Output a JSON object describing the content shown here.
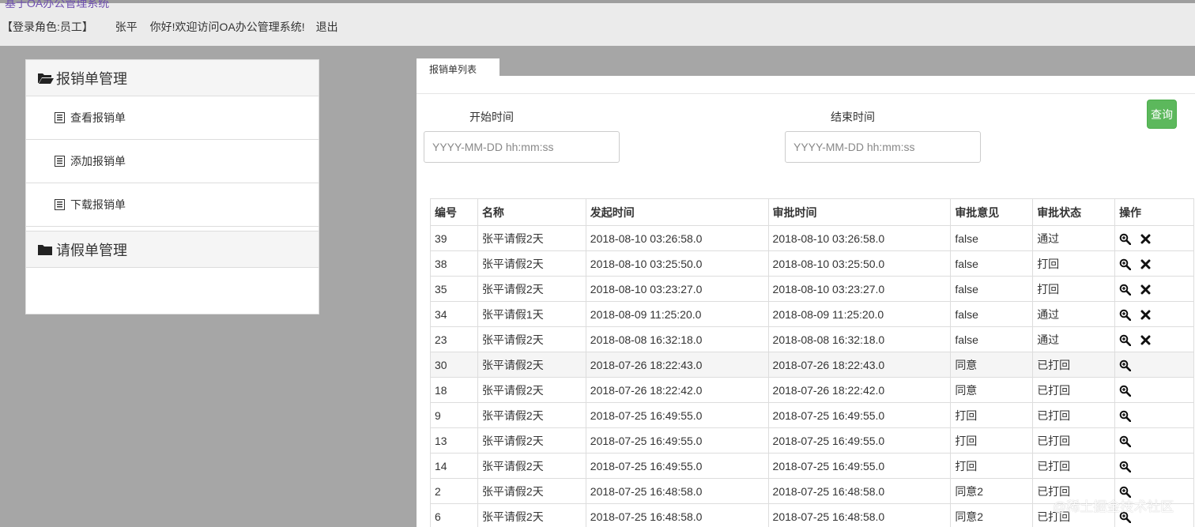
{
  "header": {
    "title_partial": "基于OA办公管理系统",
    "role": "【登录角色:员工】",
    "username": "张平",
    "greeting": "你好!欢迎访问OA办公管理系统!",
    "logout": "退出"
  },
  "sidebar": {
    "sections": [
      {
        "title": "报销单管理",
        "icon": "folder-open-icon",
        "items": [
          {
            "label": "查看报销单",
            "icon": "list-alt-icon"
          },
          {
            "label": "添加报销单",
            "icon": "list-alt-icon"
          },
          {
            "label": "下载报销单",
            "icon": "list-alt-icon"
          }
        ]
      },
      {
        "title": "请假单管理",
        "icon": "folder-closed-icon"
      }
    ]
  },
  "main": {
    "tab_label": "报销单列表",
    "filter": {
      "start_label": "开始时间",
      "end_label": "结束时间",
      "start_placeholder": "YYYY-MM-DD hh:mm:ss",
      "end_placeholder": "YYYY-MM-DD hh:mm:ss",
      "query_button": "查询"
    },
    "table": {
      "headers": [
        "编号",
        "名称",
        "发起时间",
        "审批时间",
        "审批意见",
        "审批状态",
        "操作"
      ],
      "rows": [
        {
          "id": "39",
          "name": "张平请假2天",
          "start": "2018-08-10 03:26:58.0",
          "approve": "2018-08-10 03:26:58.0",
          "opinion": "false",
          "status": "通过",
          "actions": [
            "zoom-in-icon",
            "remove-icon"
          ]
        },
        {
          "id": "38",
          "name": "张平请假2天",
          "start": "2018-08-10 03:25:50.0",
          "approve": "2018-08-10 03:25:50.0",
          "opinion": "false",
          "status": "打回",
          "actions": [
            "zoom-in-icon",
            "remove-icon"
          ]
        },
        {
          "id": "35",
          "name": "张平请假2天",
          "start": "2018-08-10 03:23:27.0",
          "approve": "2018-08-10 03:23:27.0",
          "opinion": "false",
          "status": "打回",
          "actions": [
            "zoom-in-icon",
            "remove-icon"
          ]
        },
        {
          "id": "34",
          "name": "张平请假1天",
          "start": "2018-08-09 11:25:20.0",
          "approve": "2018-08-09 11:25:20.0",
          "opinion": "false",
          "status": "通过",
          "actions": [
            "zoom-in-icon",
            "remove-icon"
          ]
        },
        {
          "id": "23",
          "name": "张平请假2天",
          "start": "2018-08-08 16:32:18.0",
          "approve": "2018-08-08 16:32:18.0",
          "opinion": "false",
          "status": "通过",
          "actions": [
            "zoom-in-icon",
            "remove-icon"
          ]
        },
        {
          "id": "30",
          "name": "张平请假2天",
          "start": "2018-07-26 18:22:43.0",
          "approve": "2018-07-26 18:22:43.0",
          "opinion": "同意",
          "status": "已打回",
          "actions": [
            "zoom-in-icon"
          ],
          "highlighted": true
        },
        {
          "id": "18",
          "name": "张平请假2天",
          "start": "2018-07-26 18:22:42.0",
          "approve": "2018-07-26 18:22:42.0",
          "opinion": "同意",
          "status": "已打回",
          "actions": [
            "zoom-in-icon"
          ]
        },
        {
          "id": "9",
          "name": "张平请假2天",
          "start": "2018-07-25 16:49:55.0",
          "approve": "2018-07-25 16:49:55.0",
          "opinion": "打回",
          "status": "已打回",
          "actions": [
            "zoom-in-icon"
          ]
        },
        {
          "id": "13",
          "name": "张平请假2天",
          "start": "2018-07-25 16:49:55.0",
          "approve": "2018-07-25 16:49:55.0",
          "opinion": "打回",
          "status": "已打回",
          "actions": [
            "zoom-in-icon"
          ]
        },
        {
          "id": "14",
          "name": "张平请假2天",
          "start": "2018-07-25 16:49:55.0",
          "approve": "2018-07-25 16:49:55.0",
          "opinion": "打回",
          "status": "已打回",
          "actions": [
            "zoom-in-icon"
          ]
        },
        {
          "id": "2",
          "name": "张平请假2天",
          "start": "2018-07-25 16:48:58.0",
          "approve": "2018-07-25 16:48:58.0",
          "opinion": "同意2",
          "status": "已打回",
          "actions": [
            "zoom-in-icon"
          ]
        },
        {
          "id": "6",
          "name": "张平请假2天",
          "start": "2018-07-25 16:48:58.0",
          "approve": "2018-07-25 16:48:58.0",
          "opinion": "同意2",
          "status": "已打回",
          "actions": [
            "zoom-in-icon"
          ]
        }
      ]
    }
  },
  "watermark": "@稀土掘金技术社区",
  "colors": {
    "page_bg": "#a6a6a6",
    "header_bg": "#ebebeb",
    "query_button": "#5cb85c",
    "table_border": "#dddddd",
    "highlight_row": "#f5f5f5"
  }
}
